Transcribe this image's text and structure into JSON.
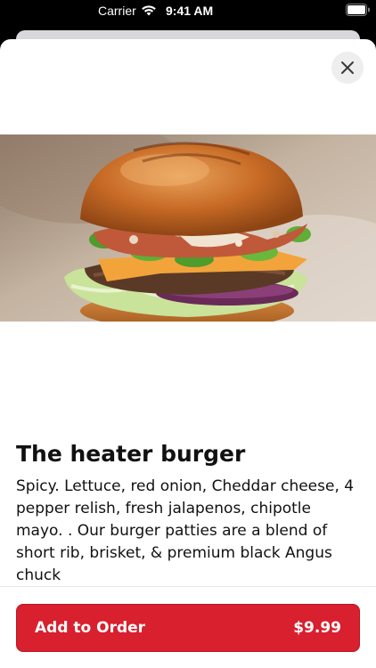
{
  "status_bar": {
    "carrier": "Carrier",
    "time": "9:41 AM",
    "wifi_icon": "wifi-icon",
    "battery_icon": "battery-icon"
  },
  "sheet": {
    "close_icon": "close-icon",
    "image_subject": "burger-photo"
  },
  "item": {
    "title": "The heater burger",
    "description": "Spicy. Lettuce, red onion, Cheddar cheese, 4 pepper relish, fresh jalapenos, chipotle mayo. . Our burger patties are a blend of short rib, brisket, & premium black Angus chuck"
  },
  "footer": {
    "add_label": "Add to Order",
    "price": "$9.99"
  },
  "colors": {
    "accent": "#d8202e",
    "text": "#111111",
    "background": "#ffffff"
  }
}
